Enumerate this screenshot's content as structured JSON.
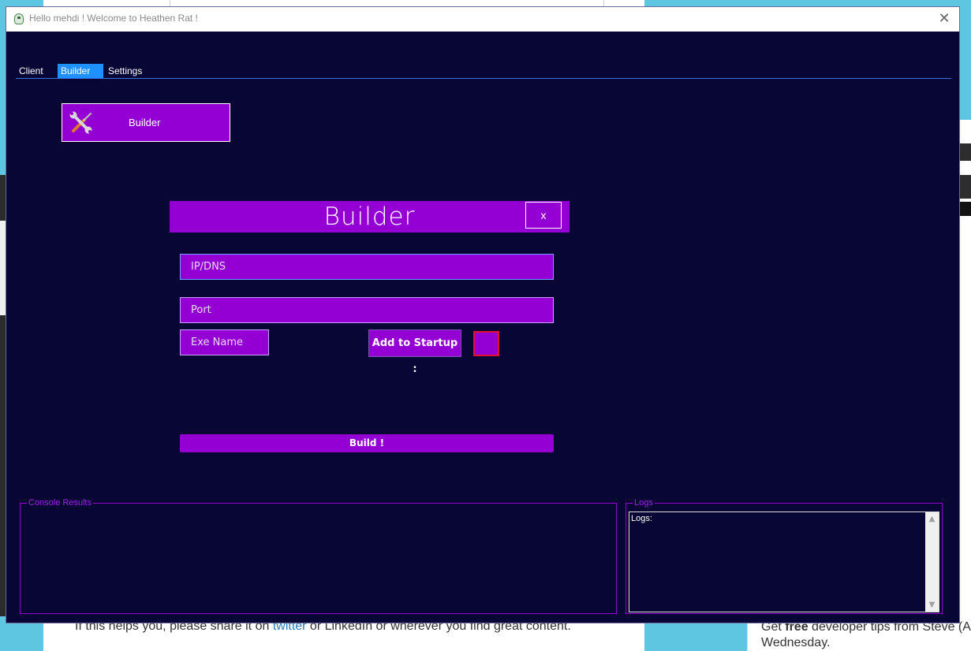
{
  "window": {
    "title": "Hello mehdi ! Welcome to Heathen Rat !",
    "close_glyph": "✕"
  },
  "tabs": [
    {
      "label": "Client",
      "active": false
    },
    {
      "label": "Builder",
      "active": true
    },
    {
      "label": "Settings",
      "active": false
    }
  ],
  "builder_tile": {
    "label": "Builder",
    "icon": "tools-icon"
  },
  "builder_panel": {
    "title": "Builder",
    "close_label": "x",
    "ip_placeholder": "IP/DNS",
    "port_placeholder": "Port",
    "exe_placeholder": "Exe Name",
    "startup_label": "Add to Startup :",
    "startup_checked": false,
    "build_label": "Build !"
  },
  "console": {
    "legend": "Console Results"
  },
  "logs": {
    "legend": "Logs",
    "text": "Logs:"
  },
  "background": {
    "bottom_left_text_pre": "If this helps you, please share it on ",
    "bottom_left_link": "twitter",
    "bottom_left_text_post": " or LinkedIn or wherever you find great content.",
    "bottom_right_pre": "Get ",
    "bottom_right_bold": "free",
    "bottom_right_post": " developer tips from Steve (A",
    "bottom_right_line2": "Wednesday."
  },
  "colors": {
    "window_bg": "#080634",
    "accent_purple": "#9400d3",
    "active_tab": "#1e90ff",
    "checkbox_border": "#e0102e"
  }
}
